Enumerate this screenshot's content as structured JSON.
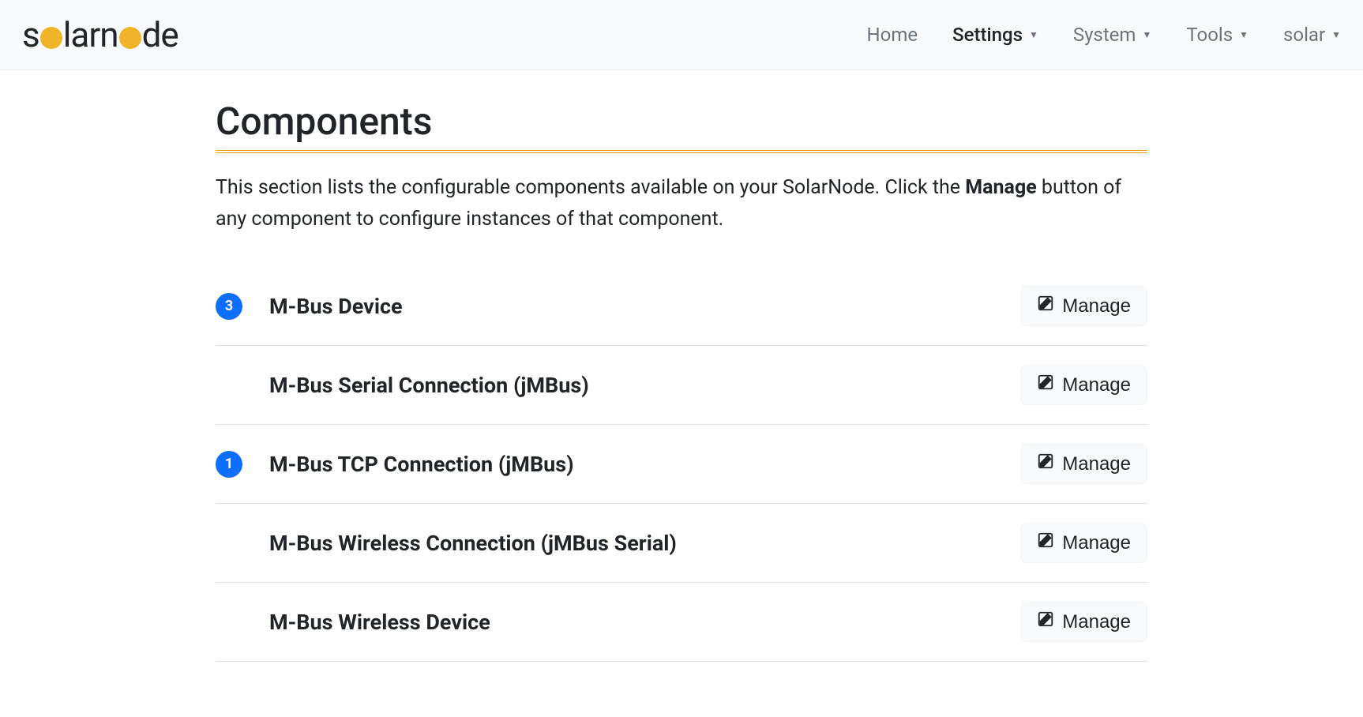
{
  "logo": {
    "part1": "s",
    "part2": "larn",
    "part3": "de"
  },
  "nav": {
    "items": [
      {
        "label": "Home",
        "dropdown": false,
        "active": false
      },
      {
        "label": "Settings",
        "dropdown": true,
        "active": true
      },
      {
        "label": "System",
        "dropdown": true,
        "active": false
      },
      {
        "label": "Tools",
        "dropdown": true,
        "active": false
      },
      {
        "label": "solar",
        "dropdown": true,
        "active": false
      }
    ]
  },
  "page": {
    "title": "Components",
    "description_pre": "This section lists the configurable components available on your SolarNode. Click the ",
    "description_bold": "Manage",
    "description_post": " button of any component to configure instances of that component."
  },
  "manage_label": "Manage",
  "components": [
    {
      "count": 3,
      "name": "M-Bus Device"
    },
    {
      "count": null,
      "name": "M-Bus Serial Connection (jMBus)"
    },
    {
      "count": 1,
      "name": "M-Bus TCP Connection (jMBus)"
    },
    {
      "count": null,
      "name": "M-Bus Wireless Connection (jMBus Serial)"
    },
    {
      "count": null,
      "name": "M-Bus Wireless Device"
    }
  ]
}
